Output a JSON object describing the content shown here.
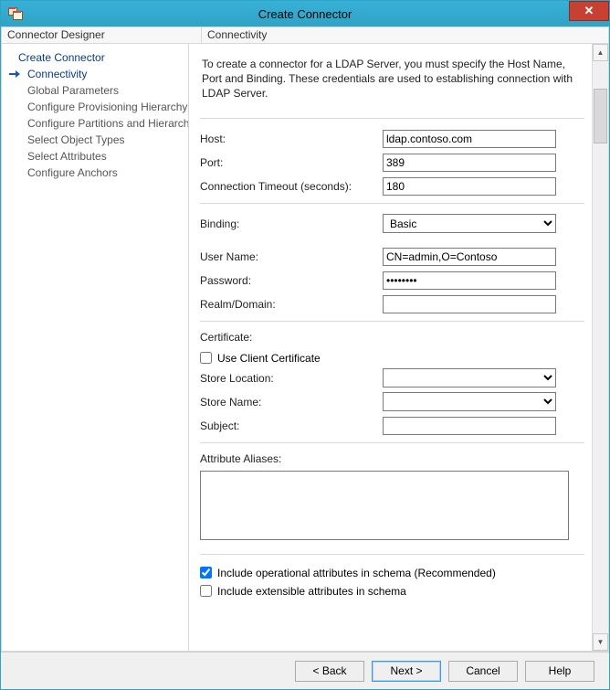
{
  "window": {
    "title": "Create Connector"
  },
  "columns": {
    "left": "Connector Designer",
    "right": "Connectivity"
  },
  "sidebar": {
    "items": [
      {
        "label": "Create Connector",
        "top": true,
        "active": false
      },
      {
        "label": "Connectivity",
        "top": false,
        "active": true
      },
      {
        "label": "Global Parameters",
        "top": false,
        "active": false
      },
      {
        "label": "Configure Provisioning Hierarchy",
        "top": false,
        "active": false
      },
      {
        "label": "Configure Partitions and Hierarchies",
        "top": false,
        "active": false
      },
      {
        "label": "Select Object Types",
        "top": false,
        "active": false
      },
      {
        "label": "Select Attributes",
        "top": false,
        "active": false
      },
      {
        "label": "Configure Anchors",
        "top": false,
        "active": false
      }
    ]
  },
  "intro": "To create a connector for a LDAP Server, you must specify the Host Name, Port and Binding. These credentials are used to establishing connection with LDAP Server.",
  "fields": {
    "host": {
      "label": "Host:",
      "value": "ldap.contoso.com"
    },
    "port": {
      "label": "Port:",
      "value": "389"
    },
    "timeout": {
      "label": "Connection Timeout (seconds):",
      "value": "180"
    },
    "binding": {
      "label": "Binding:",
      "value": "Basic"
    },
    "user": {
      "label": "User Name:",
      "value": "CN=admin,O=Contoso"
    },
    "password": {
      "label": "Password:",
      "value": "********"
    },
    "realm": {
      "label": "Realm/Domain:",
      "value": ""
    },
    "certificate_section": "Certificate:",
    "use_client_cert": {
      "label": "Use Client Certificate",
      "checked": false
    },
    "store_location": {
      "label": "Store Location:",
      "value": ""
    },
    "store_name": {
      "label": "Store Name:",
      "value": ""
    },
    "subject": {
      "label": "Subject:",
      "value": ""
    },
    "attribute_aliases": {
      "label": "Attribute Aliases:",
      "value": ""
    },
    "include_operational": {
      "label": "Include operational attributes in schema (Recommended)",
      "checked": true
    },
    "include_extensible": {
      "label": "Include extensible attributes in schema",
      "checked": false
    }
  },
  "footer": {
    "back": "<  Back",
    "next": "Next  >",
    "cancel": "Cancel",
    "help": "Help"
  }
}
